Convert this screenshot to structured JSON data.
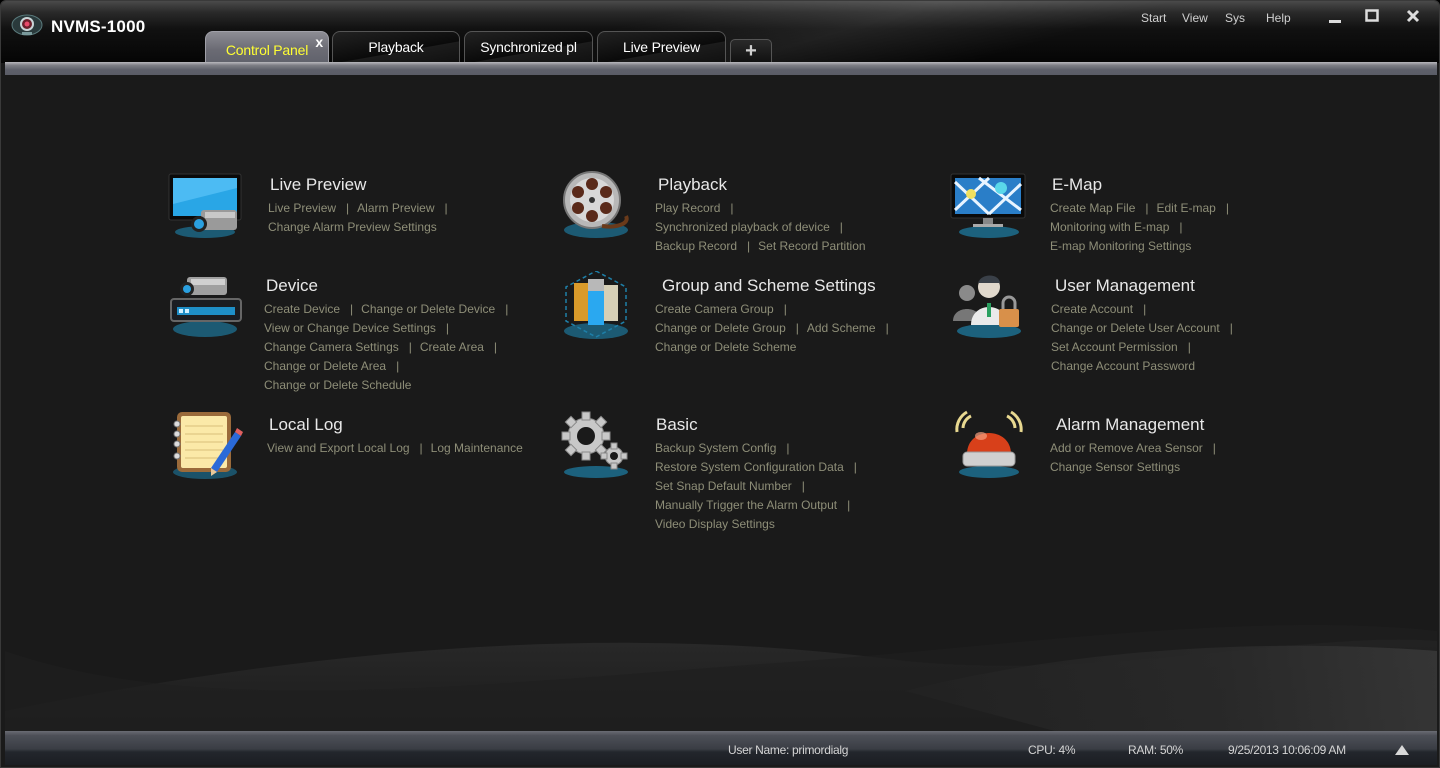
{
  "app": {
    "title": "NVMS-1000"
  },
  "menu": {
    "items": [
      "Start",
      "View",
      "Sys",
      "Help"
    ]
  },
  "window_controls": {
    "minimize": "minimize",
    "maximize": "maximize",
    "close": "close"
  },
  "tabs": [
    {
      "label": "Control Panel",
      "active": true,
      "closable": true
    },
    {
      "label": "Playback",
      "active": false
    },
    {
      "label": "Synchronized pl",
      "active": false
    },
    {
      "label": "Live Preview",
      "active": false
    }
  ],
  "tab_add_label": "+",
  "tab_close_label": "x",
  "separator": "|",
  "colors": {
    "active_tab_text": "#ffff33",
    "link": "#8e8e78",
    "title": "#e8e8e8",
    "glow": "#1ea8e0"
  },
  "modules": [
    {
      "id": "live-preview",
      "icon": "monitor-camera-icon",
      "title": "Live Preview",
      "lines": [
        [
          {
            "t": "Live Preview",
            "s": true
          },
          {
            "t": "Alarm Preview",
            "s": true
          }
        ],
        [
          {
            "t": "Change Alarm Preview Settings",
            "s": false
          }
        ]
      ]
    },
    {
      "id": "playback",
      "icon": "film-reel-icon",
      "title": "Playback",
      "lines": [
        [
          {
            "t": "Play Record",
            "s": true
          }
        ],
        [
          {
            "t": "Synchronized playback of device",
            "s": true
          }
        ],
        [
          {
            "t": "Backup Record",
            "s": true
          },
          {
            "t": "Set Record Partition",
            "s": false
          }
        ]
      ]
    },
    {
      "id": "emap",
      "icon": "map-monitor-icon",
      "title": "E-Map",
      "lines": [
        [
          {
            "t": "Create Map File",
            "s": true
          },
          {
            "t": "Edit E-map",
            "s": true
          }
        ],
        [
          {
            "t": "Monitoring with E-map",
            "s": true
          }
        ],
        [
          {
            "t": "E-map Monitoring Settings",
            "s": false
          }
        ]
      ]
    },
    {
      "id": "device",
      "icon": "dvr-camera-icon",
      "title": "Device",
      "lines": [
        [
          {
            "t": "Create Device",
            "s": true
          },
          {
            "t": "Change or Delete Device",
            "s": true
          }
        ],
        [
          {
            "t": "View or Change Device Settings",
            "s": true
          }
        ],
        [
          {
            "t": "Change Camera Settings",
            "s": true
          },
          {
            "t": "Create Area",
            "s": true
          }
        ],
        [
          {
            "t": "Change or Delete Area",
            "s": true
          }
        ],
        [
          {
            "t": "Change or Delete Schedule",
            "s": false
          }
        ]
      ]
    },
    {
      "id": "group-scheme",
      "icon": "cube-blocks-icon",
      "title": "Group and Scheme Settings",
      "lines": [
        [
          {
            "t": "Create Camera Group",
            "s": true
          }
        ],
        [
          {
            "t": "Change or Delete Group",
            "s": true
          },
          {
            "t": "Add Scheme",
            "s": true
          }
        ],
        [
          {
            "t": "Change or Delete Scheme",
            "s": false
          }
        ]
      ]
    },
    {
      "id": "user-management",
      "icon": "users-lock-icon",
      "title": "User Management",
      "lines": [
        [
          {
            "t": "Create Account",
            "s": true
          }
        ],
        [
          {
            "t": "Change or Delete User Account",
            "s": true
          }
        ],
        [
          {
            "t": "Set Account Permission",
            "s": true
          }
        ],
        [
          {
            "t": "Change Account Password",
            "s": false
          }
        ]
      ]
    },
    {
      "id": "local-log",
      "icon": "notepad-pencil-icon",
      "title": "Local Log",
      "lines": [
        [
          {
            "t": "View and Export Local Log",
            "s": true
          },
          {
            "t": "Log Maintenance",
            "s": false
          }
        ]
      ]
    },
    {
      "id": "basic",
      "icon": "gears-icon",
      "title": "Basic",
      "lines": [
        [
          {
            "t": "Backup System Config",
            "s": true
          }
        ],
        [
          {
            "t": "Restore System Configuration Data",
            "s": true
          }
        ],
        [
          {
            "t": "Set Snap Default Number",
            "s": true
          }
        ],
        [
          {
            "t": "Manually Trigger the Alarm Output",
            "s": true
          }
        ],
        [
          {
            "t": "Video Display Settings",
            "s": false
          }
        ]
      ]
    },
    {
      "id": "alarm-management",
      "icon": "alarm-beacon-icon",
      "title": "Alarm Management",
      "lines": [
        [
          {
            "t": "Add or Remove Area Sensor",
            "s": true
          }
        ],
        [
          {
            "t": "Change Sensor Settings",
            "s": false
          }
        ]
      ]
    }
  ],
  "status": {
    "user": "User Name: primordialg",
    "cpu": "CPU: 4%",
    "ram": "RAM: 50%",
    "datetime": "9/25/2013 10:06:09 AM"
  }
}
